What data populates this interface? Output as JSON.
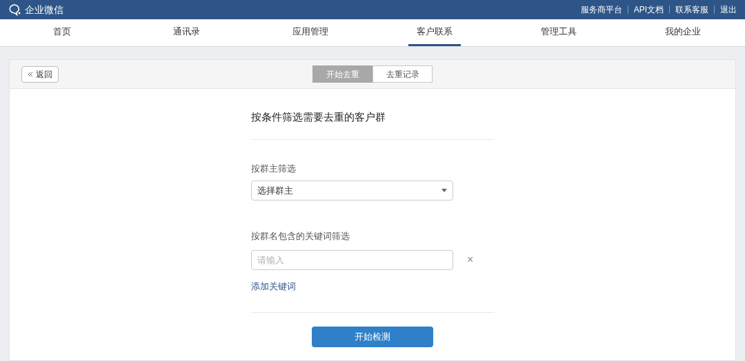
{
  "app": {
    "name": "企业微信"
  },
  "top_links": [
    "服务商平台",
    "API文档",
    "联系客服",
    "退出"
  ],
  "nav": [
    {
      "label": "首页",
      "selected": false
    },
    {
      "label": "通讯录",
      "selected": false
    },
    {
      "label": "应用管理",
      "selected": false
    },
    {
      "label": "客户联系",
      "selected": true
    },
    {
      "label": "管理工具",
      "selected": false
    },
    {
      "label": "我的企业",
      "selected": false
    }
  ],
  "back_button": {
    "label": "返回"
  },
  "tabs": [
    {
      "label": "开始去重",
      "selected": true
    },
    {
      "label": "去重记录",
      "selected": false
    }
  ],
  "form": {
    "title": "按条件筛选需要去重的客户群",
    "owner_filter": {
      "label": "按群主筛选",
      "value": "选择群主"
    },
    "keyword_filter": {
      "label": "按群名包含的关键词筛选",
      "placeholder": "请输入",
      "remove": "×"
    },
    "add_link": "添加关键词",
    "submit": "开始检测"
  }
}
